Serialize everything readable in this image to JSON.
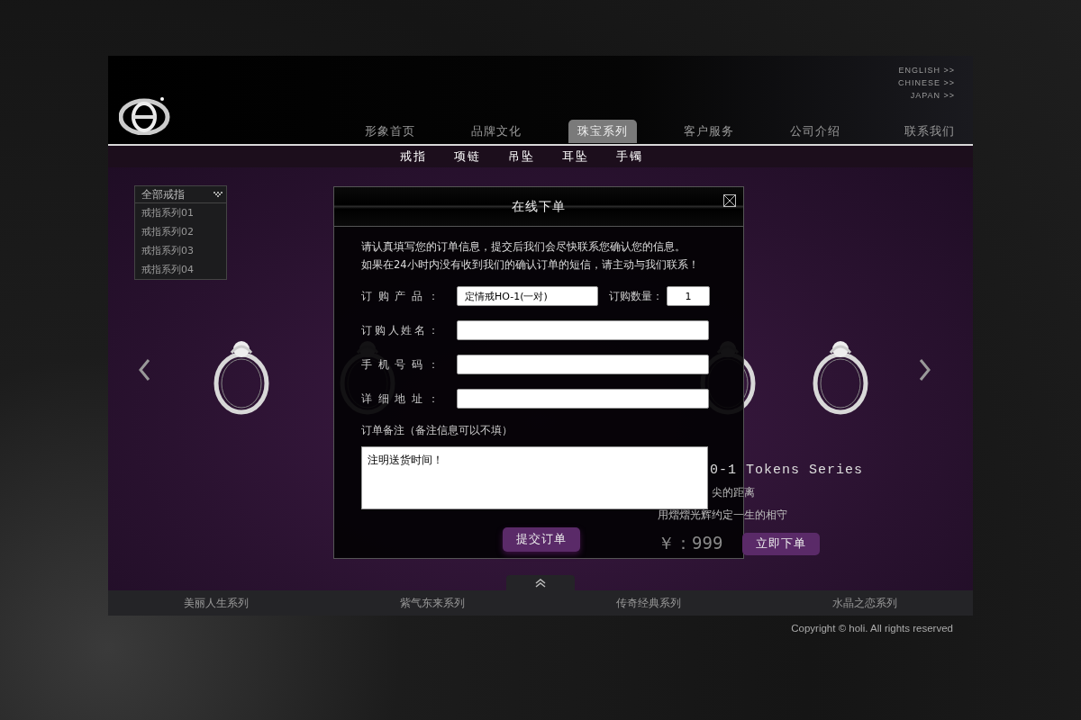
{
  "languages": [
    {
      "label": "ENGLISH >>"
    },
    {
      "label": "CHINESE >>"
    },
    {
      "label": "JAPAN >>"
    }
  ],
  "nav": [
    {
      "label": "形象首页",
      "selected": false
    },
    {
      "label": "品牌文化",
      "selected": false
    },
    {
      "label": "珠宝系列",
      "selected": true
    },
    {
      "label": "客户服务",
      "selected": false
    },
    {
      "label": "公司介绍",
      "selected": false
    },
    {
      "label": "联系我们",
      "selected": false
    }
  ],
  "subnav": [
    {
      "label": "戒指"
    },
    {
      "label": "项链"
    },
    {
      "label": "吊坠"
    },
    {
      "label": "耳坠"
    },
    {
      "label": "手镯"
    }
  ],
  "category_menu": {
    "title": "全部戒指",
    "items": [
      {
        "label": "戒指系列01"
      },
      {
        "label": "戒指系列02"
      },
      {
        "label": "戒指系列03"
      },
      {
        "label": "戒指系列04"
      }
    ]
  },
  "product": {
    "title": "0-1 Tokens Series",
    "lines": [
      "尖的距离",
      "用熠熠光辉约定一生的相守"
    ],
    "price": "￥：999",
    "button": "立即下单"
  },
  "modal": {
    "title": "在线下单",
    "intro": [
      "请认真填写您的订单信息，提交后我们会尽快联系您确认您的信息。",
      "如果在24小时内没有收到我们的确认订单的短信，请主动与我们联系！"
    ],
    "rows": [
      {
        "label": "订购产品：",
        "value": "定情戒HO-1(一对)",
        "quantity": {
          "label": "订购数量：",
          "value": "1"
        }
      },
      {
        "label": "订购人姓名："
      },
      {
        "label": "手机号码："
      },
      {
        "label": "详细地址："
      }
    ],
    "note_label": "订单备注（备注信息可以不填）",
    "note_value": "注明送货时间！",
    "submit": "提交订单"
  },
  "series": [
    {
      "label": "美丽人生系列"
    },
    {
      "label": "紫气东来系列"
    },
    {
      "label": "传奇经典系列"
    },
    {
      "label": "水晶之恋系列"
    }
  ],
  "copyright": "Copyright © holi. All rights reserved"
}
